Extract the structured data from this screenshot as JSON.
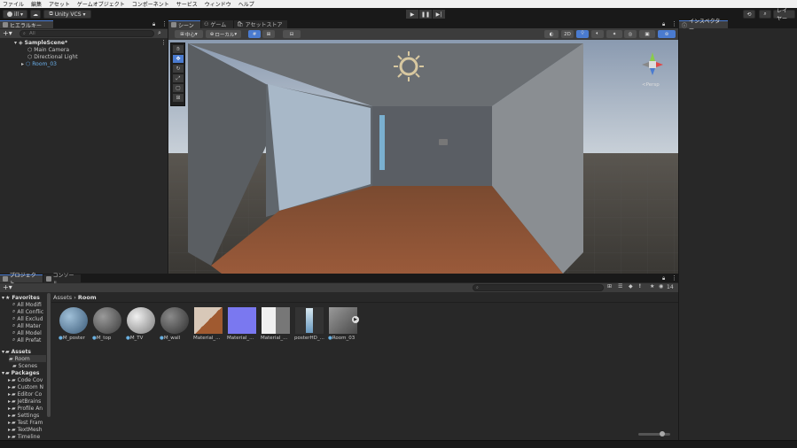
{
  "menu": [
    "ファイル",
    "編集",
    "アセット",
    "ゲームオブジェクト",
    "コンポーネント",
    "サービス",
    "ウィンドウ",
    "ヘルプ"
  ],
  "toolbar": {
    "account_label": "ill",
    "vcs_label": "Unity VCS",
    "layers_label": "レイヤー"
  },
  "hierarchy": {
    "tab_label": "ヒエラルキー",
    "search_placeholder": "All",
    "items": [
      {
        "label": "SampleScene*"
      },
      {
        "label": "Main Camera"
      },
      {
        "label": "Directional Light"
      },
      {
        "label": "Room_03"
      }
    ]
  },
  "scene": {
    "tabs": [
      "シーン",
      "ゲーム",
      "アセットストア"
    ],
    "pivot_label": "中心",
    "space_label": "ローカル",
    "mode_2d": "2D",
    "persp_label": "<Persp"
  },
  "inspector": {
    "tab_label": "インスペクター"
  },
  "project": {
    "tabs": [
      "プロジェクト",
      "コンソール"
    ],
    "breadcrumb": [
      "Assets",
      "Room"
    ],
    "hidden_count": "14",
    "favorites_label": "Favorites",
    "favorites": [
      "All Modifi",
      "All Conflic",
      "All Exclud",
      "All Mater",
      "All Model",
      "All Prefat"
    ],
    "assets_label": "Assets",
    "asset_folders": [
      "Room",
      "Scenes"
    ],
    "packages_label": "Packages",
    "packages": [
      "Code Cov",
      "Custom N",
      "Editor Co",
      "JetBrains",
      "Profile An",
      "Settings",
      "Test Fram",
      "TextMesh",
      "Timeline"
    ],
    "assets": [
      {
        "label": "M_poster",
        "color": "#5a7fa0"
      },
      {
        "label": "M_top",
        "color": "#6a6a6a"
      },
      {
        "label": "M_TV",
        "color": "#c8c8c8"
      },
      {
        "label": "M_wall",
        "color": "#5a5a5a"
      },
      {
        "label": "Material_...",
        "color": "#a05a30"
      },
      {
        "label": "Material_...",
        "color": "#7a78f0"
      },
      {
        "label": "Material_...",
        "color": "#888888"
      },
      {
        "label": "posterHD_...",
        "color": "#a0c0d8"
      },
      {
        "label": "Room_03",
        "color": "#707070"
      }
    ]
  },
  "colors": {
    "accent": "#4a7bd0",
    "floor": "#8a4a2a",
    "sky": "#b8c4d0"
  }
}
